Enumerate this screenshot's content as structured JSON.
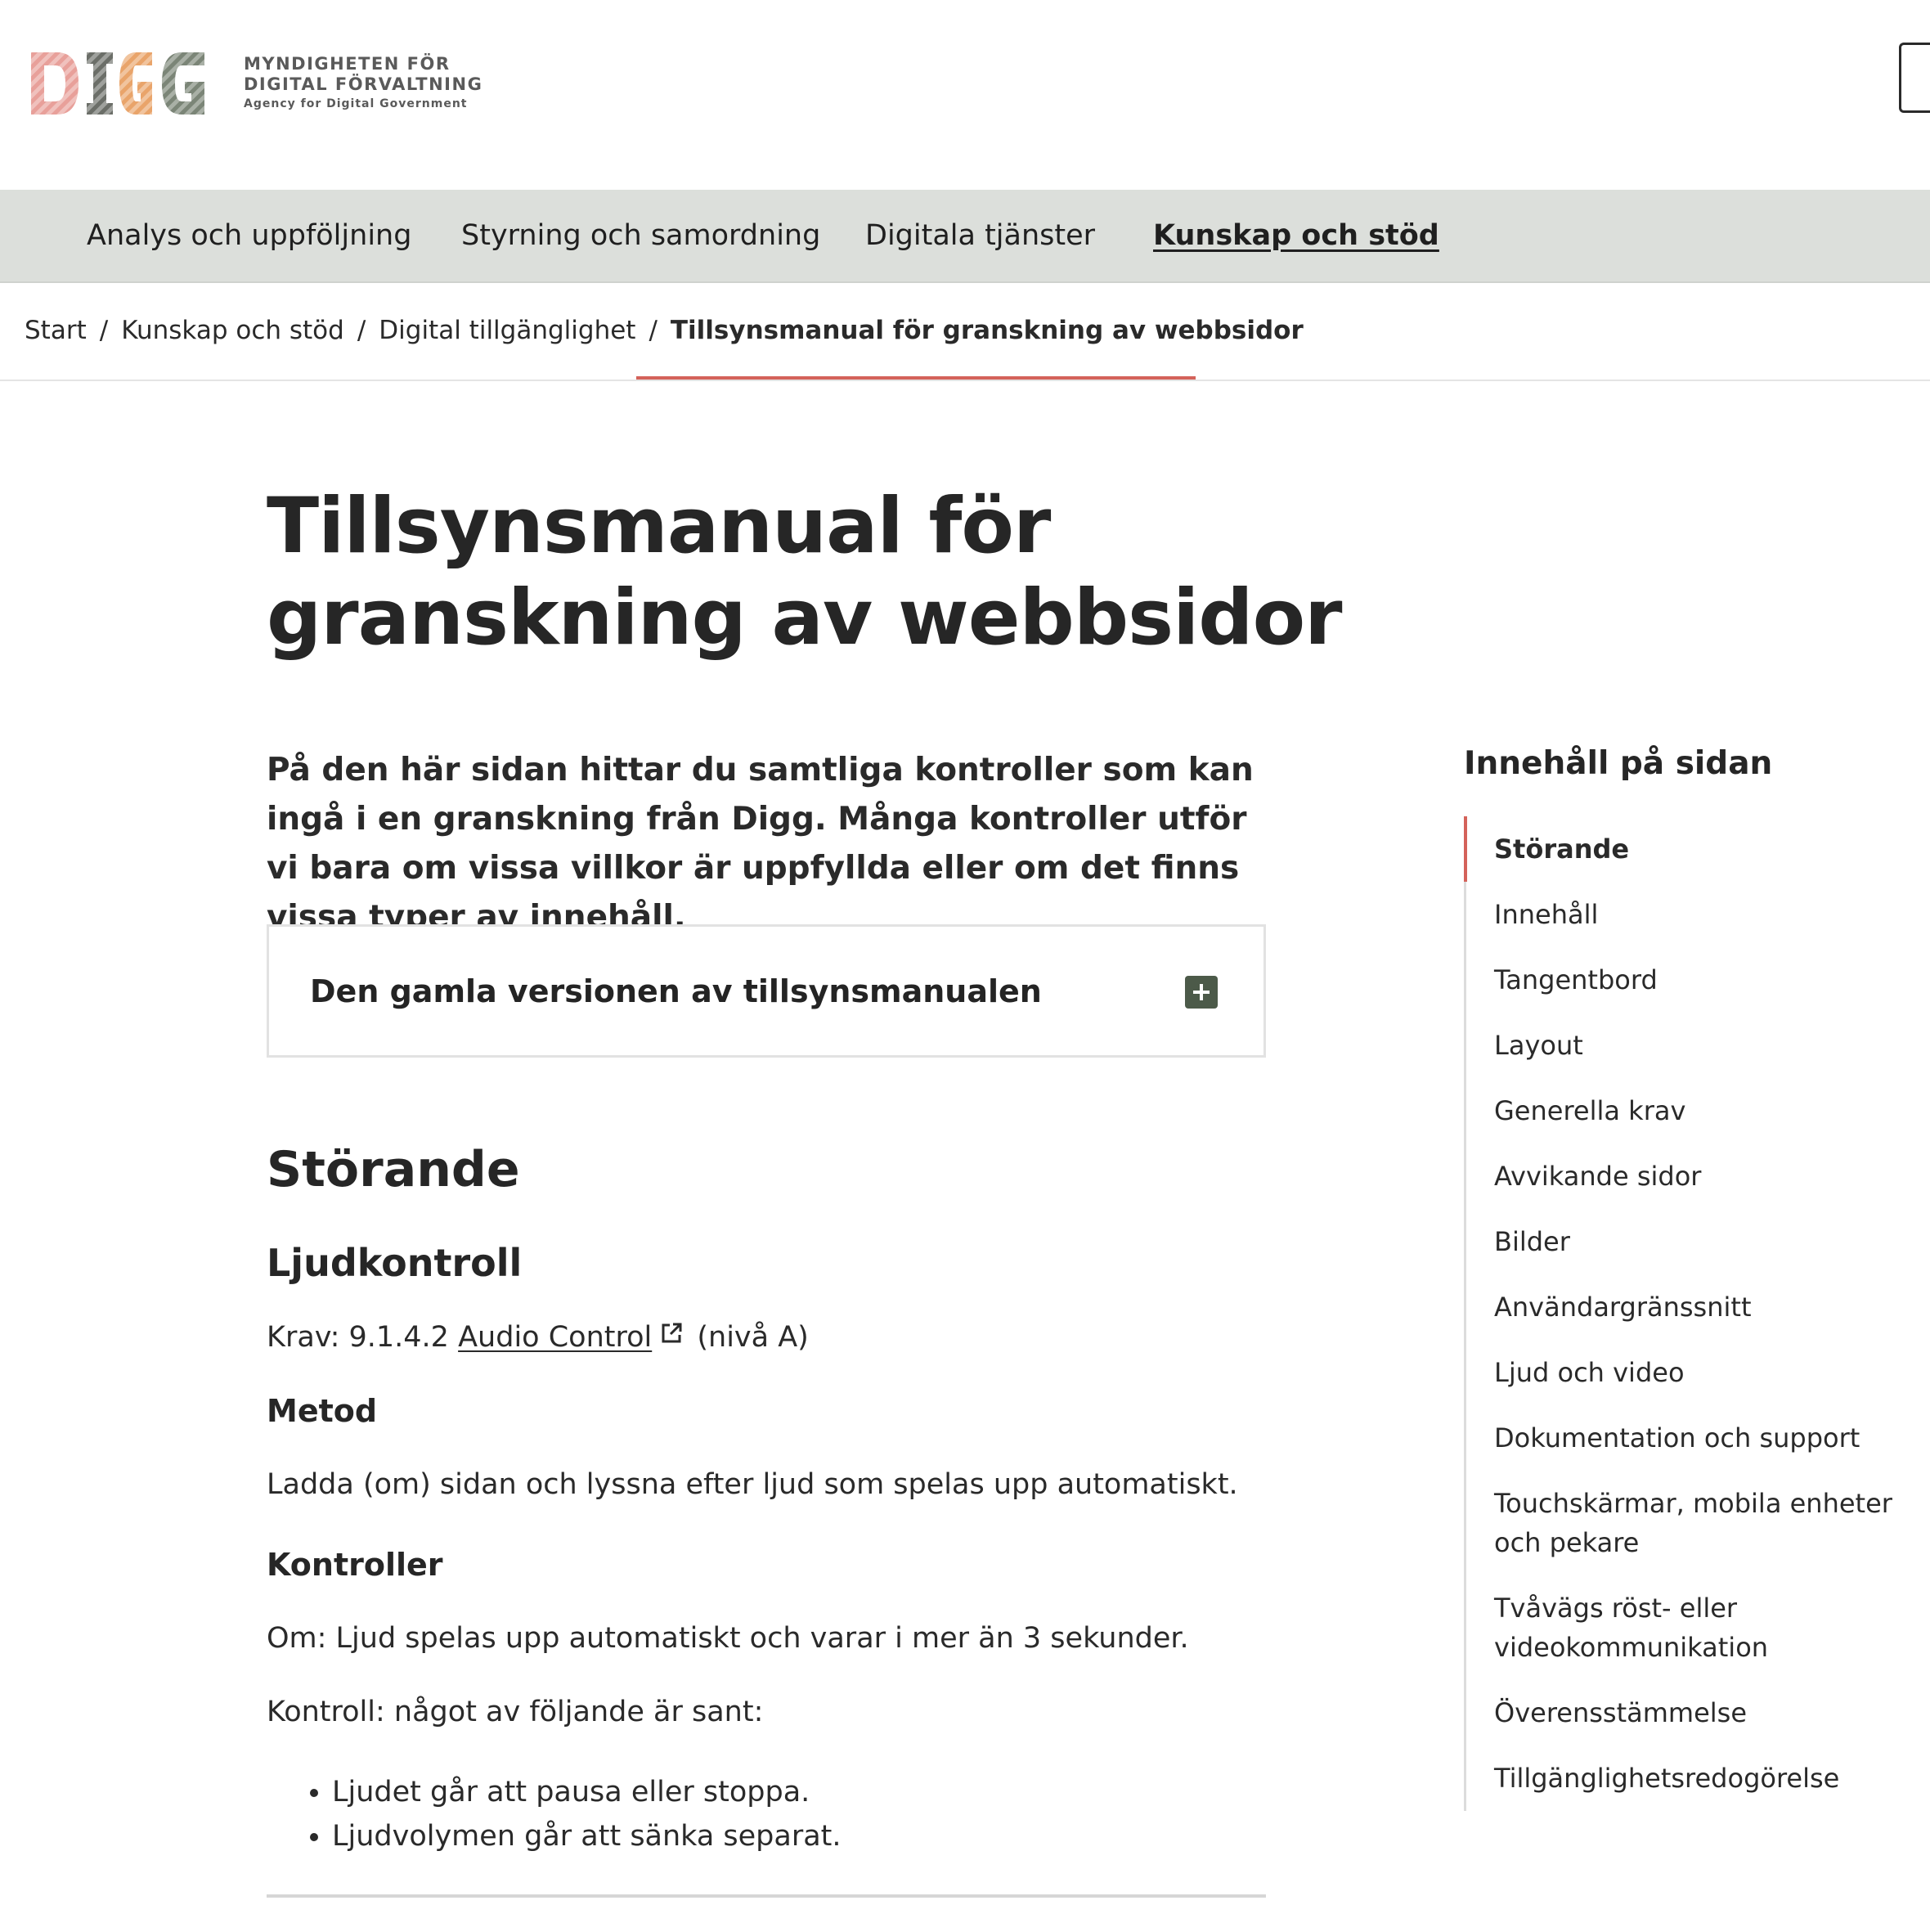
{
  "header": {
    "logo_line1": "MYNDIGHETEN FÖR",
    "logo_line2": "DIGITAL FÖRVALTNING",
    "logo_line3": "Agency for Digital Government",
    "logo_mark_text": "DIGG",
    "colors": {
      "pink": "#e8a09a",
      "gray": "#6b6e68",
      "orange": "#e9a46a",
      "green": "#7b8577"
    }
  },
  "nav": {
    "items": [
      {
        "label": "Analys och uppföljning"
      },
      {
        "label": "Styrning och samordning"
      },
      {
        "label": "Digitala tjänster"
      },
      {
        "label": "Kunskap och stöd",
        "active": true
      }
    ]
  },
  "breadcrumb": {
    "items": [
      "Start",
      "Kunskap och stöd",
      "Digital tillgänglighet"
    ],
    "separator": "/",
    "current": "Tillsynsmanual för granskning av webbsidor"
  },
  "page": {
    "title": "Tillsynsmanual för granskning av webbsidor",
    "lead": "På den här sidan hittar du samtliga kontroller som kan ingå i en granskning från Digg. Många kontroller utför vi bara om vissa villkor är uppfyllda eller om det finns vissa typer av innehåll.",
    "accordion_title": "Den gamla versionen av tillsynsmanualen"
  },
  "section": {
    "heading": "Störande",
    "subheading": "Ljudkontroll",
    "req_prefix": "Krav: 9.1.4.2",
    "req_link": "Audio Control",
    "req_suffix": "(nivå A)",
    "method_heading": "Metod",
    "method_text": "Ladda (om) sidan och lyssna efter ljud som spelas upp automatiskt.",
    "controls_heading": "Kontroller",
    "controls_if": "Om: Ljud spelas upp automatiskt och varar i mer än 3 sekunder.",
    "controls_check": "Kontroll: något av följande är sant:",
    "bullets": [
      "Ljudet går att pausa eller stoppa.",
      "Ljudvolymen går att sänka separat."
    ]
  },
  "toc": {
    "title": "Innehåll på sidan",
    "accent_color": "#d4625a",
    "items": [
      {
        "label": "Störande",
        "active": true
      },
      {
        "label": "Innehåll"
      },
      {
        "label": "Tangentbord"
      },
      {
        "label": "Layout"
      },
      {
        "label": "Generella krav"
      },
      {
        "label": "Avvikande sidor"
      },
      {
        "label": "Bilder"
      },
      {
        "label": "Användargränssnitt"
      },
      {
        "label": "Ljud och video"
      },
      {
        "label": "Dokumentation och support"
      },
      {
        "label": "Touchskärmar, mobila enheter och pekare"
      },
      {
        "label": "Tvåvägs röst- eller videokommunikation"
      },
      {
        "label": "Överensstämmelse"
      },
      {
        "label": "Tillgänglighetsredogörelse"
      }
    ]
  }
}
